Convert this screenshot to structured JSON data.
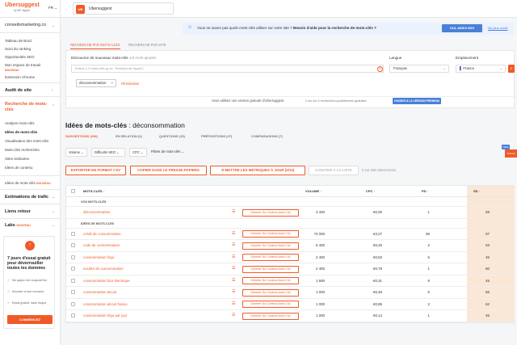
{
  "header": {
    "logo": "Ubersuggest",
    "logo_sub": "by NP digital",
    "language": "FR ⌄",
    "project_initials": "UB",
    "project_name": "Ubersuggest"
  },
  "sidebar": {
    "domain": "conseilsmarketing.co",
    "top_links": [
      "Tableau de Bord",
      "Suivi du ranking",
      "Opportunités SEO",
      "Mon espace de travail",
      "Extension Chrome"
    ],
    "new_label": "NOUVEAU",
    "site_audit": "Audit de site",
    "keyword_research": "Recherche de mots-clés",
    "keyword_links": [
      "Analyse mots-clés",
      "Idées de mots-clés",
      "Visualisation des mots-clés",
      "Mots-clés recherchés",
      "Sites similaires",
      "Idées de contenu"
    ],
    "keywords_by_site": "Idées de mots-clés",
    "traffic": "Estimations de trafic",
    "backlinks": "Liens retour",
    "labs": "Labs",
    "trial": {
      "title": "7 jours d'essai gratuit pour déverrouiller toutes les données",
      "items": [
        "Ne payez rien aujourd'hui",
        "Annulez à tout moment",
        "Essai gratuit, sans risque"
      ],
      "button": "COMMENCEZ"
    }
  },
  "help_bar": {
    "text": "Vous ne savez pas quels mots-clés utiliser sur votre site ?",
    "bold": "Besoin d'aide pour la recherche de mots-clés ?",
    "button": "OUI, AIDEZ-MOI",
    "link": "Ne plus ouvrir"
  },
  "search": {
    "tabs": [
      "RECHERCHE PAR MOTS-CLÉS",
      "RECHERCHE PAR SITE"
    ],
    "label": "Découvrez de nouveaux mots-clés",
    "label_hint": "1/3 mots ajoutés",
    "placeholder": "Entrez 1-3 mots-clés (p.ex. \"livraison de repas\")",
    "language_label": "Langue",
    "language_value": "Français",
    "location_label": "Emplacement",
    "location_value": "France",
    "chip": "déconsommation",
    "reset": "Réinitialiser",
    "quota_text": "Vous utilisez une version gratuite d'Ubersuggest",
    "quota_mid": "2 sur les 3 recherches quotidiennes gratuites",
    "quota_button": "PASSER À LA VERSION PREMIUM"
  },
  "ideas": {
    "title": "Idées de mots-clés",
    "keyword": ": déconsommation",
    "tabs": [
      "SUGGESTIONS (208)",
      "EN RELATION (2)",
      "QUESTIONS (15)",
      "PRÉPOSITIONS (27)",
      "COMPARAISONS (7)"
    ],
    "filters": [
      "Volume",
      "Difficulté SEO",
      "CPC",
      "Filtres de mots-clés"
    ],
    "actions": [
      "EXPORTER EN FORMAT CSV",
      "COPIER DANS LE PRESSE-PAPIERS",
      "METTRE LES MÉTRIQUES À JOUR (0/10)",
      "AJOUTER À LA LISTE"
    ],
    "count": "0 sur 208 sélectionnés",
    "badge_new": "NEW",
    "badge_side": "TOOLS"
  },
  "table": {
    "headers": [
      "MOTS-CLÉS",
      "VOLUME",
      "CPC",
      "PD",
      "SD"
    ],
    "group_your": "VOS MOTS-CLÉS",
    "group_ideas": "IDÉES DE MOTS-CLÉS",
    "generate_label": "Générer Du Contenu Avec L'IA",
    "your_rows": [
      {
        "kw": "déconsommation",
        "volume": "4 400",
        "cpc": "€0,00",
        "pd": "1",
        "sd": "59"
      }
    ],
    "rows": [
      {
        "kw": "crédit de consommation",
        "volume": "74 000",
        "cpc": "€3,27",
        "pd": "59",
        "sd": "57"
      },
      {
        "kw": "code de consommation",
        "volume": "5 400",
        "cpc": "€0,45",
        "pd": "2",
        "sd": "53"
      },
      {
        "kw": "consommation frigo",
        "volume": "2 400",
        "cpc": "€0,63",
        "pd": "5",
        "sd": "45"
      },
      {
        "kw": "société de consommation",
        "volume": "2 400",
        "cpc": "€0,79",
        "pd": "1",
        "sd": "60"
      },
      {
        "kw": "consommation four électrique",
        "volume": "1 600",
        "cpc": "€0,31",
        "pd": "9",
        "sd": "45"
      },
      {
        "kw": "consommation alcool",
        "volume": "1 000",
        "cpc": "€0,48",
        "pd": "6",
        "sd": "56"
      },
      {
        "kw": "consommation alcool france",
        "volume": "1 000",
        "cpc": "€0,85",
        "pd": "2",
        "sd": "62"
      },
      {
        "kw": "consommation frigo par jour",
        "volume": "1 000",
        "cpc": "€0,14",
        "pd": "1",
        "sd": "45"
      }
    ]
  }
}
